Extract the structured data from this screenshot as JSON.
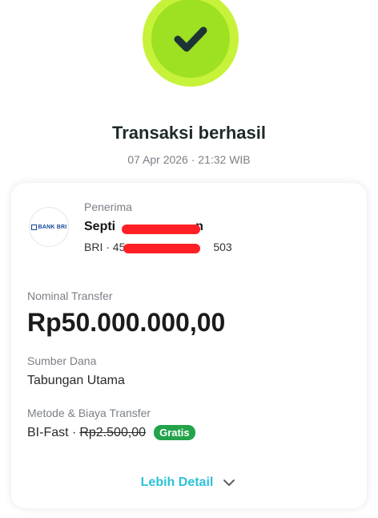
{
  "status": {
    "title": "Transaksi berhasil",
    "datetime": "07 Apr 2026 · 21:32 WIB"
  },
  "recipient": {
    "label": "Penerima",
    "name_visible": "Septi",
    "name_suffix": "n",
    "account_prefix": "BRI · 45",
    "account_suffix": "503",
    "bank_logo_text": "BANK BRI"
  },
  "nominal": {
    "label": "Nominal Transfer",
    "amount": "Rp50.000.000,00"
  },
  "source": {
    "label": "Sumber Dana",
    "value": "Tabungan Utama"
  },
  "method": {
    "label": "Metode & Biaya Transfer",
    "method_name": "BI-Fast ·",
    "original_fee": "Rp2.500,00",
    "badge": "Gratis"
  },
  "actions": {
    "more_detail": "Lebih Detail"
  },
  "icons": {
    "success": "checkmark-icon",
    "expand": "chevron-down-icon"
  },
  "colors": {
    "success_outer": "#c7f23a",
    "success_inner": "#9ee022",
    "link": "#2bc2d8",
    "badge": "#23a34a",
    "redaction": "#ff1f24"
  }
}
